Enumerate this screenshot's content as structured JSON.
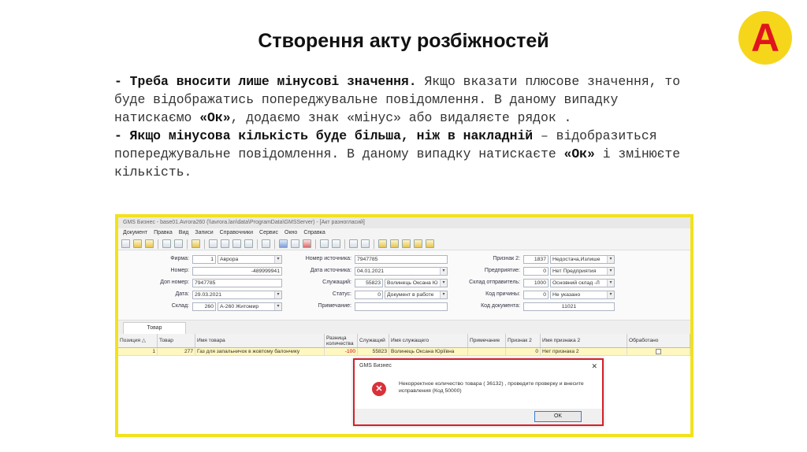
{
  "slide": {
    "title": "Створення акту розбіжностей",
    "logo_letter": "A",
    "para1_bold": "- Треба вносити лише мінусові значення.",
    "para1_text": " Якщо вказати плюсове значення, то буде відображатись попереджувальне повідомлення. В даному випадку натискаємо ",
    "para1_ok": "«Ок»",
    "para1_tail": ", додаємо знак «мінус» або видаляєте рядок .",
    "para2_bold": "- Якщо мінусова кількість буде більша, ніж в накладній",
    "para2_text": " – відобразиться попереджувальне повідомлення. В даному випадку натискаєте ",
    "para2_ok": "«Ок»",
    "para2_tail": " і змінюєте кількість."
  },
  "app": {
    "window_title": "GMS Бизнес - base01.Avrora260 (\\\\avrora.lan\\data\\ProgramData\\GMSServer) - [Акт разногласий]",
    "menu": [
      "Документ",
      "Правка",
      "Вид",
      "Записи",
      "Справочники",
      "Сервис",
      "Окно",
      "Справка"
    ],
    "form": {
      "firma_label": "Фирма:",
      "firma_code": "1",
      "firma_name": "Аврора",
      "nomer_label": "Номер:",
      "nomer_value": "-489999941",
      "dop_nomer_label": "Доп номер:",
      "dop_nomer_value": "7947785",
      "data_label": "Дата:",
      "data_value": "29.03.2021",
      "sklad_label": "Склад:",
      "sklad_code": "260",
      "sklad_name": "А-260 Житомир",
      "nomer_ist_label": "Номер источника:",
      "nomer_ist_value": "7947785",
      "data_ist_label": "Дата источника:",
      "data_ist_value": "04.01.2021",
      "sluzh_label": "Служащий:",
      "sluzh_code": "55823",
      "sluzh_name": "Волинець Оксана Ю",
      "status_label": "Статус:",
      "status_code": "0",
      "status_name": "Документ в работе",
      "primechanie_label": "Примечание:",
      "priznak2_label": "Признак 2:",
      "priznak2_code": "1837",
      "priznak2_name": "Недостача,Излише",
      "predpr_label": "Предприятие:",
      "predpr_code": "0",
      "predpr_name": "Нет Предприятия",
      "sklad_otpr_label": "Склад отправитель:",
      "sklad_otpr_code": "1000",
      "sklad_otpr_name": "Основний склад -Л",
      "kod_prichiny_label": "Код причины:",
      "kod_prichiny_code": "0",
      "kod_prichiny_name": "Не указано",
      "kod_doc_label": "Код документа:",
      "kod_doc_value": "11021"
    },
    "tab_label": "Товар",
    "grid": {
      "headers": [
        "Позиция △",
        "Товар",
        "Имя товара",
        "Разница количества",
        "Служащий",
        "Имя служащего",
        "Примечание",
        "Признак 2",
        "Имя признака 2",
        "Обработано"
      ],
      "row": [
        "1",
        "277",
        "Газ для запальничок в жовтому балончику",
        "-100",
        "55823",
        "Волинець Оксана Юріївна",
        "",
        "0",
        "Нет признака 2",
        ""
      ]
    },
    "dialog": {
      "title": "GMS Бизнес",
      "close": "✕",
      "icon": "✕",
      "message": "Некорректное количество товара ( 36132) , проведите проверку и внесите исправления (Код 50000)",
      "ok_label": "OK"
    }
  }
}
